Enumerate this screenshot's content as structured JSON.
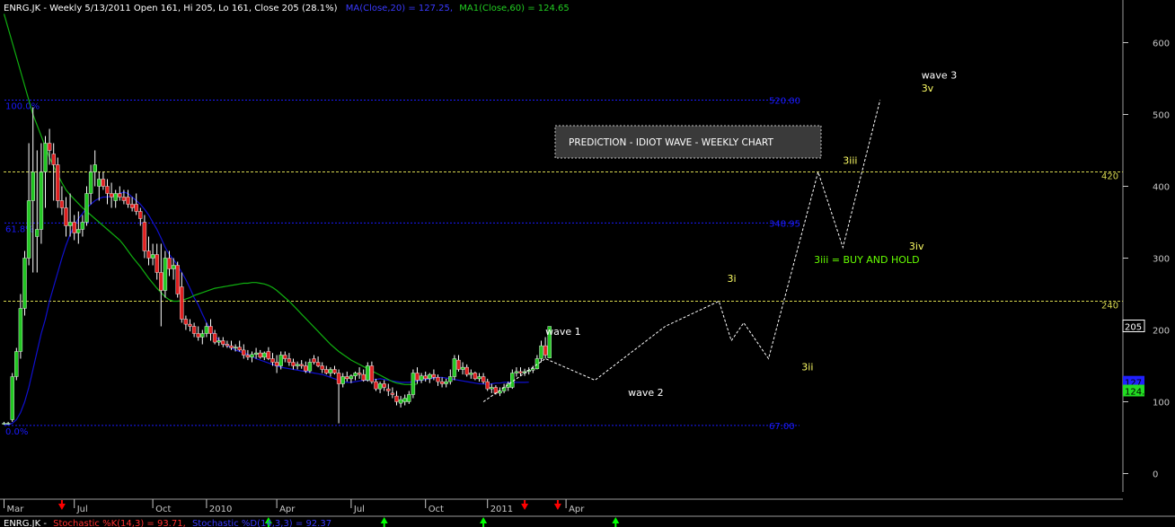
{
  "header": {
    "symbol_info": "ENRG.JK - Weekly 5/13/2011 Open 161, Hi 205, Lo 161, Close 205 (28.1%)",
    "ma20": "MA(Close,20) = 127.25,",
    "ma60": "MA1(Close,60) = 124.65"
  },
  "footer": {
    "symbol": "ENRG.JK -",
    "stoch_k": "Stochastic %K(14,3) = 93.71,",
    "stoch_d": "Stochastic %D(14,3,3) = 92.37"
  },
  "colors": {
    "background": "#000000",
    "up_candle": "#22c722",
    "down_candle": "#e02020",
    "ma20": "#1010d0",
    "ma60": "#10b010",
    "fib_line": "#1a1aff",
    "level_line": "#d8d850",
    "wave_line": "#ffffff",
    "annotation_yellow": "#ffff66",
    "annotation_green": "#66ff00",
    "axis": "#c8c8c8",
    "arrow_down": "#ff0000",
    "arrow_up": "#00ff00"
  },
  "chart_data": {
    "type": "candlestick",
    "title": "ENRG.JK - Weekly",
    "y_axis": {
      "ticks": [
        0,
        100,
        200,
        300,
        400,
        500,
        600
      ],
      "ylim": [
        -25,
        640
      ],
      "side": "right"
    },
    "x_axis": {
      "ticks": [
        "Mar",
        "Jul",
        "Oct",
        "2010",
        "Apr",
        "Jul",
        "Oct",
        "2011",
        "Apr"
      ]
    },
    "price_markers": [
      {
        "label": "205",
        "value": 205,
        "color": "#ffffff"
      },
      {
        "label": "127.25",
        "value": 127.25,
        "color": "#2020ff"
      },
      {
        "label": "124.65",
        "value": 115,
        "color": "#22dd22"
      }
    ],
    "fib_levels": [
      {
        "label_left": "100.0%",
        "label_right": "520.00",
        "value": 520
      },
      {
        "label_left": "61.8%",
        "label_right": "348.95",
        "value": 348.95
      },
      {
        "label_left": "0.0%",
        "label_right": "67.00",
        "value": 67
      }
    ],
    "levels": [
      {
        "label": "420",
        "value": 420
      },
      {
        "label": "240",
        "value": 240
      }
    ],
    "candles": [
      {
        "o": 70,
        "h": 72,
        "l": 68,
        "c": 70
      },
      {
        "o": 70,
        "h": 72,
        "l": 68,
        "c": 70
      },
      {
        "o": 75,
        "h": 140,
        "l": 72,
        "c": 135
      },
      {
        "o": 135,
        "h": 175,
        "l": 130,
        "c": 170
      },
      {
        "o": 170,
        "h": 250,
        "l": 160,
        "c": 230
      },
      {
        "o": 230,
        "h": 310,
        "l": 220,
        "c": 300
      },
      {
        "o": 300,
        "h": 460,
        "l": 290,
        "c": 380
      },
      {
        "o": 380,
        "h": 510,
        "l": 280,
        "c": 420
      },
      {
        "o": 330,
        "h": 450,
        "l": 280,
        "c": 340
      },
      {
        "o": 340,
        "h": 460,
        "l": 320,
        "c": 420
      },
      {
        "o": 420,
        "h": 470,
        "l": 370,
        "c": 460
      },
      {
        "o": 460,
        "h": 480,
        "l": 430,
        "c": 450
      },
      {
        "o": 445,
        "h": 460,
        "l": 380,
        "c": 430
      },
      {
        "o": 430,
        "h": 440,
        "l": 370,
        "c": 380
      },
      {
        "o": 380,
        "h": 400,
        "l": 360,
        "c": 370
      },
      {
        "o": 370,
        "h": 385,
        "l": 330,
        "c": 345
      },
      {
        "o": 345,
        "h": 390,
        "l": 330,
        "c": 350
      },
      {
        "o": 350,
        "h": 360,
        "l": 325,
        "c": 335
      },
      {
        "o": 335,
        "h": 365,
        "l": 320,
        "c": 340
      },
      {
        "o": 340,
        "h": 360,
        "l": 330,
        "c": 350
      },
      {
        "o": 350,
        "h": 400,
        "l": 345,
        "c": 390
      },
      {
        "o": 390,
        "h": 430,
        "l": 375,
        "c": 420
      },
      {
        "o": 420,
        "h": 450,
        "l": 400,
        "c": 430
      },
      {
        "o": 400,
        "h": 420,
        "l": 380,
        "c": 410
      },
      {
        "o": 410,
        "h": 420,
        "l": 395,
        "c": 400
      },
      {
        "o": 400,
        "h": 410,
        "l": 375,
        "c": 390
      },
      {
        "o": 390,
        "h": 405,
        "l": 370,
        "c": 385
      },
      {
        "o": 380,
        "h": 395,
        "l": 370,
        "c": 390
      },
      {
        "o": 390,
        "h": 400,
        "l": 380,
        "c": 385
      },
      {
        "o": 385,
        "h": 395,
        "l": 375,
        "c": 380
      },
      {
        "o": 385,
        "h": 395,
        "l": 370,
        "c": 375
      },
      {
        "o": 375,
        "h": 385,
        "l": 365,
        "c": 370
      },
      {
        "o": 375,
        "h": 390,
        "l": 360,
        "c": 365
      },
      {
        "o": 365,
        "h": 370,
        "l": 345,
        "c": 355
      },
      {
        "o": 350,
        "h": 360,
        "l": 300,
        "c": 310
      },
      {
        "o": 310,
        "h": 330,
        "l": 290,
        "c": 300
      },
      {
        "o": 300,
        "h": 320,
        "l": 290,
        "c": 305
      },
      {
        "o": 305,
        "h": 320,
        "l": 270,
        "c": 280
      },
      {
        "o": 280,
        "h": 320,
        "l": 205,
        "c": 255
      },
      {
        "o": 255,
        "h": 310,
        "l": 245,
        "c": 300
      },
      {
        "o": 300,
        "h": 310,
        "l": 275,
        "c": 285
      },
      {
        "o": 285,
        "h": 300,
        "l": 270,
        "c": 290
      },
      {
        "o": 290,
        "h": 295,
        "l": 245,
        "c": 250
      },
      {
        "o": 260,
        "h": 280,
        "l": 210,
        "c": 215
      },
      {
        "o": 215,
        "h": 220,
        "l": 200,
        "c": 208
      },
      {
        "o": 208,
        "h": 215,
        "l": 198,
        "c": 205
      },
      {
        "o": 205,
        "h": 210,
        "l": 190,
        "c": 195
      },
      {
        "o": 195,
        "h": 205,
        "l": 185,
        "c": 190
      },
      {
        "o": 190,
        "h": 200,
        "l": 180,
        "c": 195
      },
      {
        "o": 195,
        "h": 210,
        "l": 190,
        "c": 205
      },
      {
        "o": 205,
        "h": 215,
        "l": 185,
        "c": 195
      },
      {
        "o": 195,
        "h": 200,
        "l": 180,
        "c": 183
      },
      {
        "o": 183,
        "h": 190,
        "l": 178,
        "c": 185
      },
      {
        "o": 185,
        "h": 190,
        "l": 176,
        "c": 180
      },
      {
        "o": 180,
        "h": 185,
        "l": 175,
        "c": 178
      },
      {
        "o": 178,
        "h": 185,
        "l": 172,
        "c": 175
      },
      {
        "o": 175,
        "h": 180,
        "l": 170,
        "c": 176
      },
      {
        "o": 176,
        "h": 185,
        "l": 170,
        "c": 172
      },
      {
        "o": 172,
        "h": 180,
        "l": 160,
        "c": 165
      },
      {
        "o": 165,
        "h": 172,
        "l": 158,
        "c": 162
      },
      {
        "o": 162,
        "h": 170,
        "l": 155,
        "c": 166
      },
      {
        "o": 166,
        "h": 175,
        "l": 160,
        "c": 168
      },
      {
        "o": 168,
        "h": 172,
        "l": 160,
        "c": 162
      },
      {
        "o": 162,
        "h": 170,
        "l": 158,
        "c": 168
      },
      {
        "o": 170,
        "h": 176,
        "l": 158,
        "c": 160
      },
      {
        "o": 160,
        "h": 168,
        "l": 150,
        "c": 155
      },
      {
        "o": 155,
        "h": 165,
        "l": 140,
        "c": 150
      },
      {
        "o": 150,
        "h": 170,
        "l": 145,
        "c": 165
      },
      {
        "o": 165,
        "h": 170,
        "l": 155,
        "c": 160
      },
      {
        "o": 160,
        "h": 168,
        "l": 150,
        "c": 155
      },
      {
        "o": 155,
        "h": 160,
        "l": 145,
        "c": 150
      },
      {
        "o": 150,
        "h": 156,
        "l": 145,
        "c": 152
      },
      {
        "o": 152,
        "h": 158,
        "l": 146,
        "c": 150
      },
      {
        "o": 150,
        "h": 156,
        "l": 140,
        "c": 143
      },
      {
        "o": 143,
        "h": 160,
        "l": 140,
        "c": 155
      },
      {
        "o": 160,
        "h": 165,
        "l": 152,
        "c": 155
      },
      {
        "o": 155,
        "h": 163,
        "l": 148,
        "c": 150
      },
      {
        "o": 150,
        "h": 155,
        "l": 140,
        "c": 145
      },
      {
        "o": 145,
        "h": 150,
        "l": 138,
        "c": 140
      },
      {
        "o": 140,
        "h": 148,
        "l": 135,
        "c": 145
      },
      {
        "o": 145,
        "h": 150,
        "l": 138,
        "c": 140
      },
      {
        "o": 140,
        "h": 145,
        "l": 70,
        "c": 125
      },
      {
        "o": 125,
        "h": 140,
        "l": 120,
        "c": 135
      },
      {
        "o": 135,
        "h": 142,
        "l": 128,
        "c": 132
      },
      {
        "o": 132,
        "h": 138,
        "l": 126,
        "c": 136
      },
      {
        "o": 136,
        "h": 142,
        "l": 130,
        "c": 140
      },
      {
        "o": 140,
        "h": 148,
        "l": 132,
        "c": 138
      },
      {
        "o": 138,
        "h": 145,
        "l": 128,
        "c": 130
      },
      {
        "o": 130,
        "h": 155,
        "l": 128,
        "c": 150
      },
      {
        "o": 150,
        "h": 156,
        "l": 125,
        "c": 128
      },
      {
        "o": 128,
        "h": 132,
        "l": 115,
        "c": 118
      },
      {
        "o": 118,
        "h": 128,
        "l": 112,
        "c": 125
      },
      {
        "o": 125,
        "h": 130,
        "l": 115,
        "c": 120
      },
      {
        "o": 118,
        "h": 125,
        "l": 108,
        "c": 115
      },
      {
        "o": 112,
        "h": 120,
        "l": 105,
        "c": 110
      },
      {
        "o": 108,
        "h": 115,
        "l": 95,
        "c": 100
      },
      {
        "o": 98,
        "h": 108,
        "l": 92,
        "c": 103
      },
      {
        "o": 100,
        "h": 110,
        "l": 95,
        "c": 105
      },
      {
        "o": 100,
        "h": 115,
        "l": 97,
        "c": 110
      },
      {
        "o": 110,
        "h": 145,
        "l": 105,
        "c": 140
      },
      {
        "o": 140,
        "h": 148,
        "l": 125,
        "c": 130
      },
      {
        "o": 130,
        "h": 140,
        "l": 126,
        "c": 136
      },
      {
        "o": 136,
        "h": 142,
        "l": 128,
        "c": 132
      },
      {
        "o": 132,
        "h": 140,
        "l": 126,
        "c": 138
      },
      {
        "o": 138,
        "h": 145,
        "l": 130,
        "c": 134
      },
      {
        "o": 134,
        "h": 138,
        "l": 122,
        "c": 128
      },
      {
        "o": 128,
        "h": 134,
        "l": 120,
        "c": 125
      },
      {
        "o": 125,
        "h": 132,
        "l": 120,
        "c": 128
      },
      {
        "o": 128,
        "h": 145,
        "l": 124,
        "c": 135
      },
      {
        "o": 135,
        "h": 165,
        "l": 130,
        "c": 160
      },
      {
        "o": 158,
        "h": 165,
        "l": 142,
        "c": 145
      },
      {
        "o": 145,
        "h": 155,
        "l": 138,
        "c": 148
      },
      {
        "o": 148,
        "h": 152,
        "l": 135,
        "c": 138
      },
      {
        "o": 138,
        "h": 145,
        "l": 132,
        "c": 140
      },
      {
        "o": 140,
        "h": 142,
        "l": 130,
        "c": 132
      },
      {
        "o": 132,
        "h": 140,
        "l": 128,
        "c": 135
      },
      {
        "o": 135,
        "h": 140,
        "l": 125,
        "c": 128
      },
      {
        "o": 128,
        "h": 132,
        "l": 115,
        "c": 118
      },
      {
        "o": 118,
        "h": 125,
        "l": 112,
        "c": 120
      },
      {
        "o": 120,
        "h": 123,
        "l": 110,
        "c": 112
      },
      {
        "o": 112,
        "h": 120,
        "l": 108,
        "c": 115
      },
      {
        "o": 115,
        "h": 125,
        "l": 112,
        "c": 120
      },
      {
        "o": 120,
        "h": 128,
        "l": 115,
        "c": 125
      },
      {
        "o": 120,
        "h": 145,
        "l": 118,
        "c": 140
      },
      {
        "o": 140,
        "h": 148,
        "l": 135,
        "c": 142
      },
      {
        "o": 142,
        "h": 148,
        "l": 136,
        "c": 140
      },
      {
        "o": 140,
        "h": 146,
        "l": 136,
        "c": 142
      },
      {
        "o": 142,
        "h": 148,
        "l": 138,
        "c": 144
      },
      {
        "o": 144,
        "h": 150,
        "l": 140,
        "c": 146
      },
      {
        "o": 146,
        "h": 165,
        "l": 145,
        "c": 160
      },
      {
        "o": 160,
        "h": 185,
        "l": 155,
        "c": 178
      },
      {
        "o": 178,
        "h": 190,
        "l": 160,
        "c": 165
      },
      {
        "o": 161,
        "h": 205,
        "l": 161,
        "c": 205
      }
    ],
    "ma20": [
      68,
      68,
      70,
      75,
      85,
      100,
      120,
      145,
      170,
      195,
      215,
      240,
      260,
      280,
      300,
      318,
      333,
      345,
      355,
      362,
      370,
      375,
      380,
      383,
      385,
      385,
      386,
      388,
      390,
      392,
      390,
      385,
      380,
      375,
      368,
      360,
      350,
      340,
      328,
      315,
      305,
      298,
      290,
      280,
      270,
      258,
      245,
      235,
      222,
      210,
      200,
      192,
      186,
      182,
      178,
      175,
      172,
      170,
      168,
      166,
      163,
      160,
      158,
      156,
      154,
      152,
      150,
      148,
      147,
      146,
      145,
      144,
      143,
      142,
      141,
      140,
      139,
      138,
      136,
      134,
      132,
      130,
      128,
      127,
      127,
      128,
      129,
      130,
      130,
      131,
      131,
      132,
      131,
      130,
      129,
      128,
      127,
      127,
      127,
      128,
      129,
      130,
      131,
      132,
      133,
      134,
      134,
      133,
      132,
      131,
      130,
      129,
      128,
      127,
      126,
      125,
      125,
      124,
      125,
      126,
      126,
      127,
      127,
      127,
      127,
      127,
      127,
      127.25
    ],
    "ma60": [
      640,
      620,
      600,
      580,
      560,
      540,
      520,
      500,
      485,
      470,
      455,
      440,
      428,
      416,
      405,
      395,
      388,
      382,
      376,
      370,
      365,
      360,
      355,
      350,
      345,
      340,
      335,
      330,
      325,
      318,
      310,
      302,
      295,
      288,
      280,
      272,
      265,
      258,
      252,
      246,
      242,
      240,
      240,
      241,
      243,
      245,
      248,
      250,
      252,
      254,
      256,
      258,
      259,
      260,
      261,
      262,
      263,
      264,
      265,
      265,
      266,
      266,
      265,
      264,
      262,
      259,
      255,
      250,
      245,
      240,
      234,
      228,
      222,
      216,
      210,
      204,
      198,
      192,
      186,
      180,
      175,
      170,
      166,
      162,
      158,
      155,
      152,
      149,
      146,
      143,
      140,
      137,
      134,
      131,
      128,
      126,
      125,
      124,
      124,
      124,
      124.65
    ],
    "wave_path": [
      {
        "week": 116,
        "value": 100
      },
      {
        "week": 131,
        "value": 160
      },
      {
        "week": 143,
        "value": 130
      },
      {
        "week": 160,
        "value": 205
      },
      {
        "week": 173,
        "value": 240
      },
      {
        "week": 176,
        "value": 185
      },
      {
        "week": 179,
        "value": 210
      },
      {
        "week": 185,
        "value": 160
      },
      {
        "week": 197,
        "value": 420
      },
      {
        "week": 203,
        "value": 315
      },
      {
        "week": 212,
        "value": 520
      }
    ],
    "annotations": [
      {
        "text": "wave 1",
        "week": 131,
        "value": 193,
        "color": "#ffffff"
      },
      {
        "text": "wave 2",
        "week": 151,
        "value": 108,
        "color": "#ffffff"
      },
      {
        "text": "3i",
        "week": 175,
        "value": 267,
        "color": "#ffff66"
      },
      {
        "text": "3ii",
        "week": 193,
        "value": 144,
        "color": "#ffff66"
      },
      {
        "text": "3iii",
        "week": 203,
        "value": 431,
        "color": "#ffff66"
      },
      {
        "text": "3iv",
        "week": 219,
        "value": 312,
        "color": "#ffff66"
      },
      {
        "text": "wave 3",
        "week": 222,
        "value": 550,
        "color": "#ffffff"
      },
      {
        "text": "3v",
        "week": 222,
        "value": 532,
        "color": "#ffff66"
      },
      {
        "text": "3iii = BUY AND HOLD",
        "week": 196,
        "value": 293,
        "color": "#66ff00"
      }
    ],
    "signals": [
      {
        "week": 14,
        "dir": "down"
      },
      {
        "week": 64,
        "dir": "up"
      },
      {
        "week": 92,
        "dir": "up"
      },
      {
        "week": 116,
        "dir": "up"
      },
      {
        "week": 126,
        "dir": "down"
      },
      {
        "week": 134,
        "dir": "down"
      },
      {
        "week": 148,
        "dir": "up"
      }
    ],
    "x_tick_weeks": [
      0,
      17,
      36,
      49,
      66,
      84,
      102,
      117,
      136
    ],
    "prediction_box": "PREDICTION - IDIOT WAVE - WEEKLY CHART"
  }
}
